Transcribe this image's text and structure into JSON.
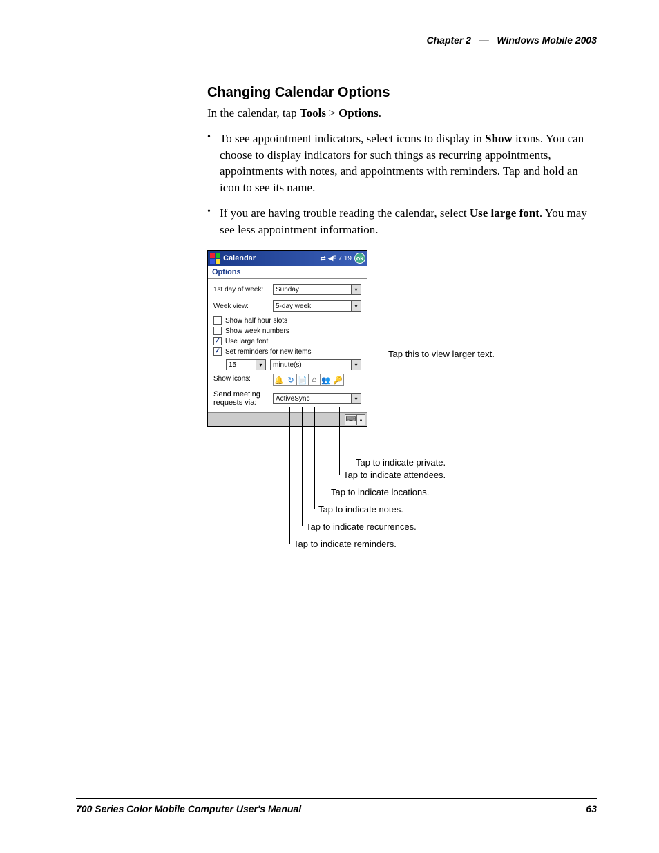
{
  "header": {
    "chapter": "Chapter 2",
    "separator": "—",
    "title": "Windows Mobile 2003"
  },
  "section": {
    "heading": "Changing Calendar Options",
    "intro_prefix": "In the calendar, tap ",
    "intro_tools": "Tools",
    "intro_gt": " > ",
    "intro_options": "Options",
    "intro_suffix": ".",
    "bullets": [
      {
        "t1": "To see appointment indicators, select icons to display in ",
        "b1": "Show",
        "t2": " icons. You can choose to display indicators for such things as recurring appointments, appointments with notes, and appointments with reminders. Tap and hold an icon to see its name."
      },
      {
        "t1": "If you are having trouble reading the calendar, select ",
        "b1": "Use large font",
        "t2": ". You may see less appointment information."
      }
    ]
  },
  "device": {
    "title": "Calendar",
    "time": "7:19",
    "ok": "ok",
    "options_label": "Options",
    "first_day_label": "1st day of week:",
    "first_day_value": "Sunday",
    "week_view_label": "Week view:",
    "week_view_value": "5-day week",
    "chk_halfhour": "Show half hour slots",
    "chk_weeknums": "Show week numbers",
    "chk_largefont": "Use large font",
    "chk_reminders": "Set reminders for new items",
    "reminder_num": "15",
    "reminder_unit": "minute(s)",
    "show_icons_label": "Show icons:",
    "icons": {
      "reminder": "🔔",
      "recurrence": "↻",
      "note": "📄",
      "location": "⌂",
      "attendees": "👥",
      "private": "🔑"
    },
    "send_label_l1": "Send meeting",
    "send_label_l2": "requests via:",
    "send_value": "ActiveSync"
  },
  "callouts": {
    "largefont": "Tap this to view larger text.",
    "private": "Tap to indicate private.",
    "attendees": "Tap to indicate attendees.",
    "locations": "Tap to indicate locations.",
    "notes": "Tap to indicate notes.",
    "recurrences": "Tap to indicate recurrences.",
    "reminders": "Tap to indicate reminders."
  },
  "footer": {
    "left": "700 Series Color Mobile Computer User's Manual",
    "right": "63"
  }
}
